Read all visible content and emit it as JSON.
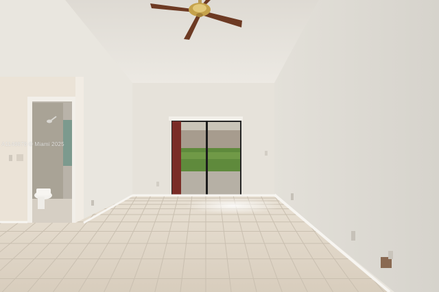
{
  "watermark": {
    "text": "A1148878 © Miami 2025"
  },
  "colors": {
    "ceiling": "#e4e1dc",
    "ceiling_left": "#ddd9d2",
    "wall_back": "#e6e2da",
    "wall_right": "#dddad3",
    "wall_left": "#e8e5de",
    "partition": "#eae2d6",
    "floor_tile": "#ddd3c5",
    "grout": "#cbc1b3",
    "baseboard": "#f6f4f0",
    "curtain": "#7a2c26",
    "door_frame": "#262626",
    "hedge": "#5f8a3c",
    "fan_blade": "#6d3a23",
    "fan_brass": "#c5a24b"
  },
  "icons": [
    "ceiling-fan-icon",
    "shower-head-icon",
    "toilet-icon",
    "outlet-icon"
  ]
}
